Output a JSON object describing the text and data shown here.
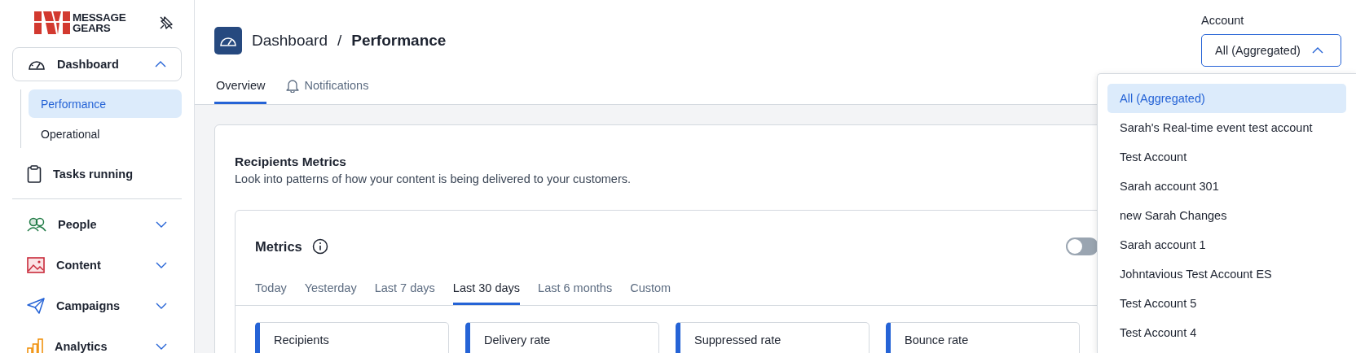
{
  "sidebar": {
    "logo": {
      "line_1": "MESSAGE",
      "line_2": "GEARS"
    },
    "items": [
      {
        "label": "Dashboard",
        "kind": "group",
        "expanded": true,
        "children": [
          {
            "label": "Performance",
            "selected": true
          },
          {
            "label": "Operational",
            "selected": false
          }
        ]
      },
      {
        "label": "Tasks running",
        "kind": "link"
      },
      {
        "label": "People",
        "kind": "group",
        "expanded": false
      },
      {
        "label": "Content",
        "kind": "group",
        "expanded": false
      },
      {
        "label": "Campaigns",
        "kind": "group",
        "expanded": false
      },
      {
        "label": "Analytics",
        "kind": "group",
        "expanded": false
      }
    ]
  },
  "header": {
    "breadcrumb": {
      "parent": "Dashboard",
      "separator": "/",
      "current": "Performance"
    },
    "tabs": [
      {
        "label": "Overview",
        "selected": true
      },
      {
        "label": "Notifications",
        "selected": false
      }
    ]
  },
  "account": {
    "label": "Account",
    "value": "All (Aggregated)",
    "expanded": true,
    "options": [
      {
        "label": "All (Aggregated)",
        "selected": true
      },
      {
        "label": "Sarah's Real-time event test account",
        "selected": false
      },
      {
        "label": "Test Account",
        "selected": false
      },
      {
        "label": "Sarah account 301",
        "selected": false
      },
      {
        "label": "new Sarah Changes",
        "selected": false
      },
      {
        "label": "Sarah account 1",
        "selected": false
      },
      {
        "label": "Johntavious Test Account ES",
        "selected": false
      },
      {
        "label": "Test Account 5",
        "selected": false
      },
      {
        "label": "Test Account 4",
        "selected": false
      }
    ]
  },
  "recipients_metrics": {
    "title": "Recipients Metrics",
    "description": "Look into patterns of how your content is being delivered to your customers.",
    "metrics": {
      "title": "Metrics",
      "toggle": {
        "on": false
      },
      "ranges": [
        {
          "label": "Today",
          "selected": false
        },
        {
          "label": "Yesterday",
          "selected": false
        },
        {
          "label": "Last 7 days",
          "selected": false
        },
        {
          "label": "Last 30 days",
          "selected": true
        },
        {
          "label": "Last 6 months",
          "selected": false
        },
        {
          "label": "Custom",
          "selected": false
        }
      ],
      "cards": [
        {
          "label": "Recipients"
        },
        {
          "label": "Delivery rate"
        },
        {
          "label": "Suppressed rate"
        },
        {
          "label": "Bounce rate"
        }
      ]
    }
  }
}
